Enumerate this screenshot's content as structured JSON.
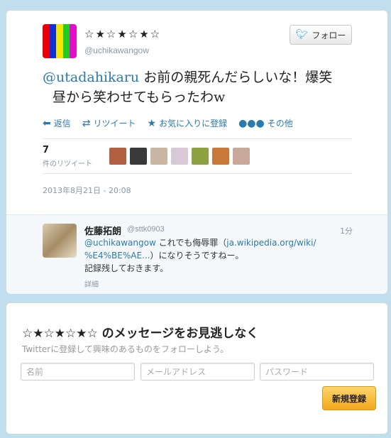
{
  "tweet": {
    "display_name": "☆★☆★☆★☆",
    "screen_name": "@uchikawangow",
    "follow_label": "フォロー",
    "mention": "@utadahikaru",
    "text_line1": " お前の親死んだらしいな！爆笑",
    "text_line2": "昼から笑わせてもらったわw",
    "actions": {
      "reply": "返信",
      "retweet": "リツイート",
      "favorite": "お気に入りに登録",
      "more": "その他"
    },
    "retweet_count": "7",
    "retweet_count_label": "件のリツイート",
    "timestamp": "2013年8月21日 - 20:08",
    "avatar_colors": [
      "#e8000b",
      "#1030d8",
      "#f2e600",
      "#22cc22",
      "#e010c8"
    ],
    "retweeter_colors": [
      "#b06040",
      "#3a3a3a",
      "#c9b6a2",
      "#d8c8d8",
      "#8fa040",
      "#c87838",
      "#c8a898",
      "#8a3f2a"
    ]
  },
  "reply": {
    "name": "佐藤拓朗",
    "handle": "@sttk0903",
    "time": "1分",
    "mention": "@uchikawangow",
    "text_a": " これでも侮辱罪（",
    "link_a": "ja.wikipedia.org/wiki/",
    "link_b": "%E4%BE%AE...",
    "text_b": "）になりそうですねー。",
    "text_c": "記録残しておきます。",
    "detail": "詳細"
  },
  "signup": {
    "title": "☆★☆★☆★☆ のメッセージをお見逃しなく",
    "subtitle": "Twitterに登録して興味のあるものをフォローしよう。",
    "name_placeholder": "名前",
    "email_placeholder": "メールアドレス",
    "password_placeholder": "パスワード",
    "button": "新規登録"
  },
  "colors": {
    "link": "#2a7ab0",
    "background": "#c0deed",
    "button_orange": "#f2a81c"
  }
}
